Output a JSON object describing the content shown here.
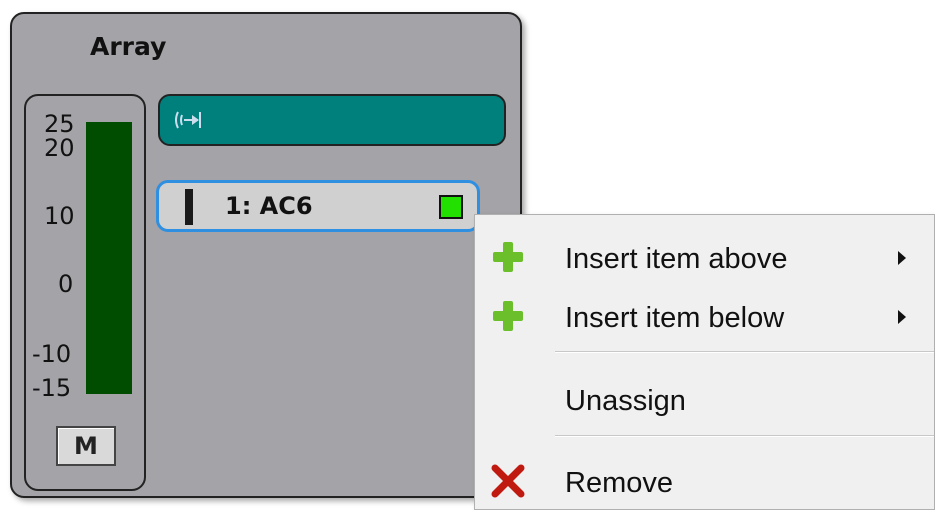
{
  "panel": {
    "title": "Array",
    "meter": {
      "ticks": [
        "25",
        "20",
        "10",
        "0",
        "-10",
        "-15"
      ],
      "bar_color": "#004d00",
      "mute_label": "M"
    },
    "slots": {
      "empty_slot_icon": "speaker-connect-icon",
      "empty_slot_color": "#00807d",
      "item": {
        "label": "1: AC6",
        "status_color": "#22e000",
        "selected_border_color": "#2f8fe0"
      }
    }
  },
  "context_menu": {
    "items": [
      {
        "label": "Insert item above",
        "icon": "plus-icon",
        "has_submenu": true
      },
      {
        "label": "Insert item below",
        "icon": "plus-icon",
        "has_submenu": true
      },
      {
        "label": "Unassign",
        "icon": "",
        "has_submenu": false
      },
      {
        "label": "Remove",
        "icon": "remove-x-icon",
        "has_submenu": false
      }
    ]
  }
}
